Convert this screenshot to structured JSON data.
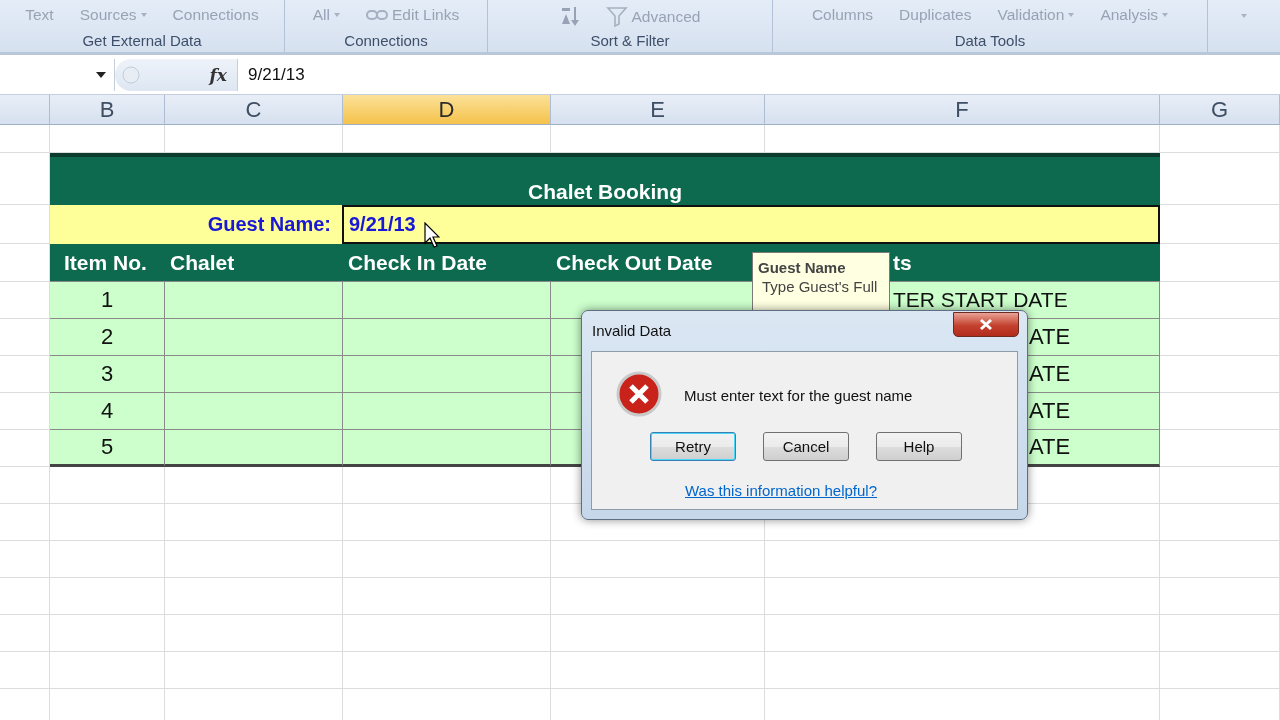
{
  "ribbon": {
    "groups": [
      {
        "label": "Get External Data",
        "buttons": [
          {
            "label": "Text",
            "dropdown": false,
            "disabled": true
          },
          {
            "label": "Sources",
            "dropdown": true,
            "disabled": true
          },
          {
            "label": "Connections",
            "dropdown": false,
            "disabled": true
          }
        ]
      },
      {
        "label": "Connections",
        "buttons": [
          {
            "label": "All",
            "dropdown": true,
            "disabled": true
          },
          {
            "label": "Edit Links",
            "kind": "link",
            "dropdown": false,
            "disabled": true
          }
        ]
      },
      {
        "label": "Sort & Filter",
        "buttons": [
          {
            "kind": "sort",
            "dropdown": false,
            "disabled": true
          },
          {
            "label": "Advanced",
            "kind": "filter",
            "dropdown": false,
            "disabled": true
          }
        ]
      },
      {
        "label": "Data Tools",
        "buttons": [
          {
            "label": "Columns",
            "dropdown": false,
            "disabled": true
          },
          {
            "label": "Duplicates",
            "dropdown": false,
            "disabled": true
          },
          {
            "label": "Validation",
            "dropdown": true,
            "disabled": true
          },
          {
            "label": "Analysis",
            "dropdown": true,
            "disabled": true
          }
        ]
      }
    ]
  },
  "formula_bar": {
    "function_label": "fx",
    "value": "9/21/13"
  },
  "columns": [
    {
      "letter": "B",
      "selected": false
    },
    {
      "letter": "C",
      "selected": false
    },
    {
      "letter": "D",
      "selected": true
    },
    {
      "letter": "E",
      "selected": false
    },
    {
      "letter": "F",
      "selected": false
    },
    {
      "letter": "G",
      "selected": false
    }
  ],
  "booking": {
    "title": "Chalet Booking",
    "guest_label": "Guest Name:",
    "guest_value": "9/21/13",
    "headers": [
      "Item No.",
      "Chalet",
      "Check In Date",
      "Check Out Date",
      "ts"
    ],
    "rows": [
      {
        "item": "1",
        "column_f": "TER START DATE"
      },
      {
        "item": "2",
        "column_f": "ATE"
      },
      {
        "item": "3",
        "column_f": "ATE"
      },
      {
        "item": "4",
        "column_f": "ATE"
      },
      {
        "item": "5",
        "column_f": "ATE"
      }
    ]
  },
  "tooltip": {
    "title": "Guest Name",
    "text": "Type Guest's Full"
  },
  "dialog": {
    "title": "Invalid Data",
    "message": "Must enter text for the guest name",
    "buttons": [
      {
        "label": "Retry",
        "focused": true
      },
      {
        "label": "Cancel",
        "focused": false
      },
      {
        "label": "Help",
        "focused": false
      }
    ],
    "link": "Was this information helpful?"
  }
}
